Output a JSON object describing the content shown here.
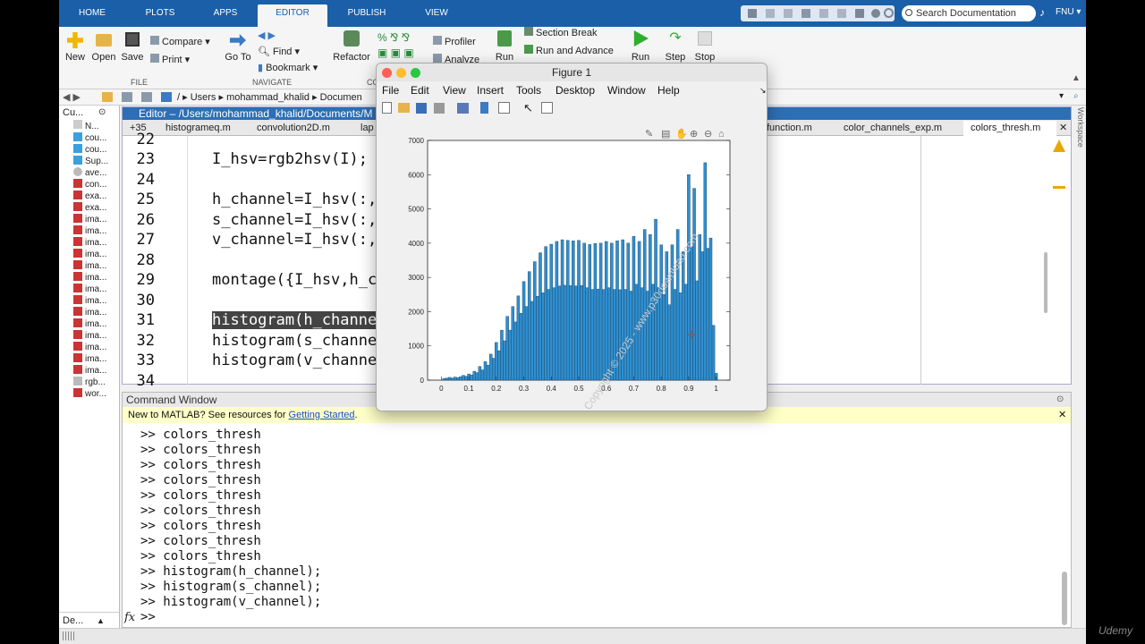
{
  "tabs": [
    "HOME",
    "PLOTS",
    "APPS",
    "EDITOR",
    "PUBLISH",
    "VIEW"
  ],
  "search_placeholder": "Search Documentation",
  "user": "FNU",
  "ribbon": {
    "new": "New",
    "open": "Open",
    "save": "Save",
    "compare": "Compare",
    "print": "Print",
    "goto": "Go To",
    "find": "Find",
    "bookmark": "Bookmark",
    "refactor": "Refactor",
    "profiler": "Profiler",
    "analyze": "Analyze",
    "run_section": "Run",
    "section_break": "Section Break",
    "run_advance": "Run and Advance",
    "run": "Run",
    "step": "Step",
    "stop": "Stop",
    "group_file": "FILE",
    "group_navigate": "NAVIGATE",
    "group_code": "CO"
  },
  "address": [
    "/",
    "Users",
    "mohammad_khalid",
    "Documen"
  ],
  "left_panel": {
    "title": "Cu...",
    "header": "N...",
    "items": [
      "cou...",
      "cou...",
      "Sup...",
      "ave...",
      "con...",
      "exa...",
      "exa...",
      "ima...",
      "ima...",
      "ima...",
      "ima...",
      "ima...",
      "ima...",
      "ima...",
      "ima...",
      "ima...",
      "ima...",
      "ima...",
      "ima...",
      "ima...",
      "ima...",
      "rgb...",
      "wor..."
    ],
    "bottom": "De..."
  },
  "editor": {
    "title": "Editor – /Users/mohammad_khalid/Documents/M",
    "tabs": [
      "+35",
      "histogrameq.m",
      "convolution2D.m",
      "lap",
      "function.m",
      "color_channels_exp.m",
      "colors_thresh.m"
    ],
    "lines": [
      {
        "n": "22",
        "t": ""
      },
      {
        "n": "23",
        "t": "I_hsv=rgb2hsv(I);"
      },
      {
        "n": "24",
        "t": ""
      },
      {
        "n": "25",
        "t": "h_channel=I_hsv(:,"
      },
      {
        "n": "26",
        "t": "s_channel=I_hsv(:,"
      },
      {
        "n": "27",
        "t": "v_channel=I_hsv(:,"
      },
      {
        "n": "28",
        "t": ""
      },
      {
        "n": "29",
        "t": "montage({I_hsv,h_c"
      },
      {
        "n": "30",
        "t": ""
      },
      {
        "n": "31",
        "t": "histogram(h_channe"
      },
      {
        "n": "32",
        "t": "histogram(s_channe"
      },
      {
        "n": "33",
        "t": "histogram(v_channe"
      },
      {
        "n": "34",
        "t": ""
      }
    ]
  },
  "command": {
    "title": "Command Window",
    "banner_prefix": "New to MATLAB? See resources for ",
    "banner_link": "Getting Started",
    "banner_suffix": ".",
    "lines": [
      ">> colors_thresh",
      ">> colors_thresh",
      ">> colors_thresh",
      ">> colors_thresh",
      ">> colors_thresh",
      ">> colors_thresh",
      ">> colors_thresh",
      ">> colors_thresh",
      ">> colors_thresh",
      ">> histogram(h_channel);",
      ">> histogram(s_channel);",
      ">> histogram(v_channel);"
    ],
    "prompt": ">>"
  },
  "figure": {
    "title": "Figure 1",
    "menu": [
      "File",
      "Edit",
      "View",
      "Insert",
      "Tools",
      "Desktop",
      "Window",
      "Help"
    ]
  },
  "workspace_label": "Workspace",
  "watermark": "Copyright © 2025 - www.p30download.com",
  "brand": "Udemy",
  "chart_data": {
    "type": "bar",
    "xlim": [
      -0.05,
      1.05
    ],
    "ylim": [
      0,
      7000
    ],
    "xticks": [
      "0",
      "0.1",
      "0.2",
      "0.3",
      "0.4",
      "0.5",
      "0.6",
      "0.7",
      "0.8",
      "0.9",
      "1"
    ],
    "yticks": [
      "0",
      "1000",
      "2000",
      "3000",
      "4000",
      "5000",
      "6000",
      "7000"
    ],
    "bar_color": "#2f8fd0",
    "x": [
      0.0,
      0.01,
      0.02,
      0.03,
      0.04,
      0.05,
      0.06,
      0.07,
      0.08,
      0.09,
      0.1,
      0.11,
      0.12,
      0.13,
      0.14,
      0.15,
      0.16,
      0.17,
      0.18,
      0.19,
      0.2,
      0.21,
      0.22,
      0.23,
      0.24,
      0.25,
      0.26,
      0.27,
      0.28,
      0.29,
      0.3,
      0.31,
      0.32,
      0.33,
      0.34,
      0.35,
      0.36,
      0.37,
      0.38,
      0.39,
      0.4,
      0.41,
      0.42,
      0.43,
      0.44,
      0.45,
      0.46,
      0.47,
      0.48,
      0.49,
      0.5,
      0.51,
      0.52,
      0.53,
      0.54,
      0.55,
      0.56,
      0.57,
      0.58,
      0.59,
      0.6,
      0.61,
      0.62,
      0.63,
      0.64,
      0.65,
      0.66,
      0.67,
      0.68,
      0.69,
      0.7,
      0.71,
      0.72,
      0.73,
      0.74,
      0.75,
      0.76,
      0.77,
      0.78,
      0.79,
      0.8,
      0.81,
      0.82,
      0.83,
      0.84,
      0.85,
      0.86,
      0.87,
      0.88,
      0.89,
      0.9,
      0.91,
      0.92,
      0.93,
      0.94,
      0.95,
      0.96,
      0.97,
      0.98,
      0.99,
      1.0
    ],
    "values": [
      0,
      50,
      60,
      80,
      60,
      90,
      70,
      100,
      140,
      110,
      180,
      150,
      260,
      220,
      400,
      300,
      540,
      440,
      760,
      640,
      1100,
      860,
      1460,
      1150,
      1860,
      1460,
      2150,
      1700,
      2460,
      1950,
      2880,
      2150,
      3170,
      2300,
      3460,
      2450,
      3720,
      2550,
      3900,
      2650,
      3970,
      2700,
      4050,
      2750,
      4100,
      2770,
      4080,
      2760,
      4070,
      2750,
      4080,
      2760,
      4000,
      2700,
      3960,
      2650,
      3990,
      2660,
      4000,
      2650,
      4050,
      2700,
      4000,
      2650,
      4070,
      2640,
      4100,
      2650,
      4000,
      2600,
      4200,
      2800,
      4050,
      2700,
      4400,
      2600,
      4250,
      2800,
      4700,
      2700,
      3950,
      2500,
      3750,
      2200,
      3950,
      2650,
      4400,
      2550,
      3750,
      2800,
      6000,
      3900,
      5600,
      2900,
      4250,
      3750,
      6350,
      3850,
      4150,
      1600,
      200
    ]
  }
}
